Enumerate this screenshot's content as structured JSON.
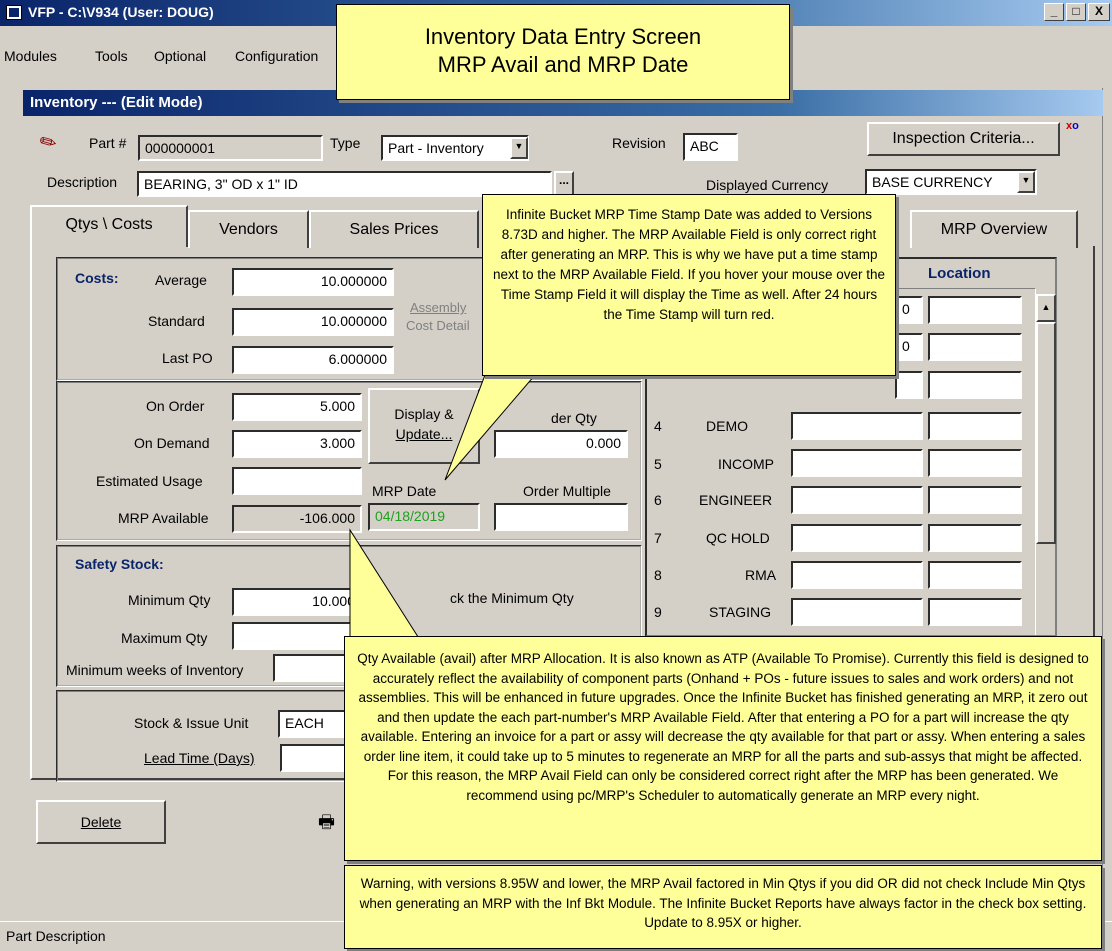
{
  "app": {
    "title": "VFP - C:\\V934  (User: DOUG)",
    "minimize": "_",
    "maximize": "□",
    "close": "X"
  },
  "menu": [
    "Modules",
    "Tools",
    "Optional",
    "Configuration"
  ],
  "window": {
    "title": "Inventory --- (Edit Mode)"
  },
  "header": {
    "part_label": "Part #",
    "part_value": "000000001",
    "type_label": "Type",
    "type_value": "Part - Inventory",
    "revision_label": "Revision",
    "revision_value": "ABC",
    "inspection_button": "Inspection Criteria...",
    "description_label": "Description",
    "description_value": "BEARING, 3\" OD x 1\" ID",
    "ellipsis": "...",
    "currency_label": "Displayed Currency",
    "currency_value": "BASE CURRENCY"
  },
  "tabs": [
    "Qtys \\ Costs",
    "Vendors",
    "Sales Prices",
    "MRP Overview"
  ],
  "costs": {
    "heading": "Costs:",
    "average_label": "Average",
    "average_value": "10.000000",
    "standard_label": "Standard",
    "standard_value": "10.000000",
    "lastpo_label": "Last PO",
    "lastpo_value": "6.000000",
    "assembly_btn": "Assembly",
    "cost_detail": "Cost Detail"
  },
  "qtys": {
    "onorder_label": "On Order",
    "onorder_value": "5.000",
    "ondemand_label": "On Demand",
    "ondemand_value": "3.000",
    "estusage_label": "Estimated Usage",
    "estusage_value": "",
    "mrpavail_label": "MRP Available",
    "mrpavail_value": "-106.000",
    "display_btn_1": "Display &",
    "display_btn_2": "Update...",
    "order_qty_label": "der Qty",
    "order_qty_value": "0.000",
    "mrp_date_label": "MRP Date",
    "mrp_date_value": "04/18/2019",
    "order_multiple_label": "Order Multiple",
    "order_multiple_value": ""
  },
  "safety": {
    "heading": "Safety Stock:",
    "min_label": "Minimum Qty",
    "min_value": "10.000",
    "check_text": "ck the Minimum Qty",
    "max_label": "Maximum Qty",
    "weeks_label": "Minimum weeks of Inventory"
  },
  "units": {
    "stock_label": "Stock & Issue Unit",
    "stock_value": "EACH",
    "lead_label": "Lead Time (Days)"
  },
  "buttons": {
    "delete": "Delete"
  },
  "locations": {
    "header": "Location",
    "rows": [
      {
        "num": "4",
        "name": "DEMO"
      },
      {
        "num": "5",
        "name": "INCOMP"
      },
      {
        "num": "6",
        "name": "ENGINEER"
      },
      {
        "num": "7",
        "name": "QC HOLD"
      },
      {
        "num": "8",
        "name": "RMA"
      },
      {
        "num": "9",
        "name": "STAGING"
      }
    ],
    "partial_top": [
      "0",
      "0"
    ]
  },
  "callouts": {
    "title_line1": "Inventory Data Entry Screen",
    "title_line2": "MRP Avail and MRP Date",
    "timestamp": "Infinite Bucket MRP Time Stamp Date was added to Versions 8.73D and higher.  The MRP Available Field is only correct right after generating an MRP.  This is why we have put a time stamp next to the MRP Available Field.  If you hover your mouse over the Time Stamp Field it will display the Time as well.  After 24 hours the Time Stamp will turn red.",
    "qty_available": "Qty Available (avail) after MRP Allocation.  It is also known as ATP (Available To Promise).  Currently this field is designed to accurately reflect the availability of component parts (Onhand + POs - future issues to sales and work orders) and not assemblies.  This will be enhanced in future upgrades.  Once the Infinite Bucket has finished generating an MRP, it zero out and then update the each part-number's MRP Available Field.  After that entering a PO for a part will increase the qty available.  Entering an invoice for a part or assy will decrease the qty available for that part or assy.  When entering a sales order line item, it could take up to 5 minutes to regenerate an MRP for all the parts and sub-assys that might be affected.  For this reason, the MRP Avail Field can only be considered correct right after the MRP has been generated.  We recommend using pc/MRP's Scheduler to automatically generate an MRP every night.",
    "warning": "Warning, with versions 8.95W and lower, the MRP Avail factored in Min Qtys if you did OR did not check Include Min Qtys when generating an MRP with the Inf Bkt Module.  The Infinite Bucket Reports have always factor in the check box setting.  Update to 8.95X or higher."
  },
  "status": {
    "text": "Part Description"
  },
  "colors": {
    "titlebar": "#0a246a",
    "callout": "#ffff99",
    "mrp_date_text": "#20a020",
    "heading_blue": "#0a246a"
  }
}
